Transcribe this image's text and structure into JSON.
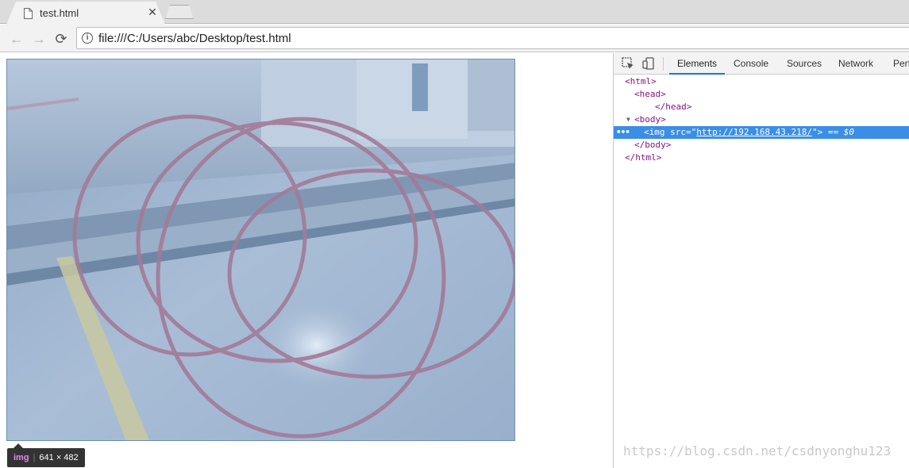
{
  "tab": {
    "title": "test.html",
    "close_icon": "close-icon",
    "favicon": "page-icon"
  },
  "toolbar": {
    "back_icon": "back-arrow-icon",
    "forward_icon": "forward-arrow-icon",
    "reload_icon": "reload-icon",
    "info_icon": "info-icon",
    "url": "file:///C:/Users/abc/Desktop/test.html"
  },
  "page": {
    "image_tooltip": {
      "tag": "img",
      "size": "641 × 482"
    }
  },
  "devtools": {
    "tools": [
      "inspect-element-icon",
      "device-toolbar-icon"
    ],
    "tabs": [
      {
        "label": "Elements",
        "selected": true
      },
      {
        "label": "Console",
        "selected": false
      },
      {
        "label": "Sources",
        "selected": false
      },
      {
        "label": "Network",
        "selected": false
      },
      {
        "label": "Perf",
        "selected": false
      }
    ],
    "dom": {
      "html_open": "<html>",
      "head_open": "<head>",
      "head_close": "</head>",
      "body_open": "<body>",
      "img_open": "<img",
      "img_attr_name": "src=",
      "img_attr_quote_open": "\"",
      "img_attr_value": "http://192.168.43.218/",
      "img_attr_quote_close": "\">",
      "img_suffix": " == $0",
      "selected_dots": "•••",
      "body_close": "</body>",
      "html_close": "</html>"
    },
    "watermark": "https://blog.csdn.net/csdnyonghu123"
  },
  "colors": {
    "selection_blue": "#3b8ee6",
    "tag_purple": "#881280",
    "tab_underline": "#1a73e8"
  }
}
